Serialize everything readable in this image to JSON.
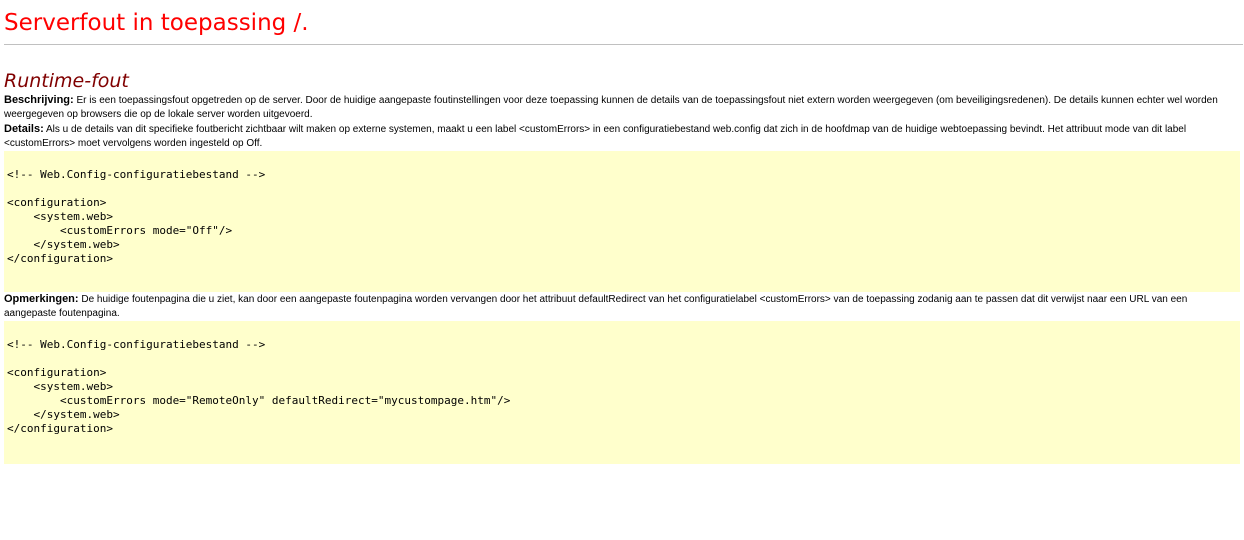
{
  "page": {
    "title": "Serverfout in toepassing /.",
    "subtitle": "Runtime-fout"
  },
  "description": {
    "label": "Beschrijving:",
    "text": " Er is een toepassingsfout opgetreden op de server. Door de huidige aangepaste foutinstellingen voor deze toepassing kunnen de details van de toepassingsfout niet extern worden weergegeven (om beveiligingsredenen). De details kunnen echter wel worden weergegeven op browsers die op de lokale server worden uitgevoerd."
  },
  "details": {
    "label": "Details:",
    "text": " Als u de details van dit specifieke foutbericht zichtbaar wilt maken op externe systemen, maakt u een label <customErrors> in een configuratiebestand web.config dat zich in de hoofdmap van de huidige webtoepassing bevindt. Het attribuut mode van dit label <customErrors> moet vervolgens worden ingesteld op Off."
  },
  "code_block_1": [
    "<!-- Web.Config-configuratiebestand -->",
    "",
    "<configuration>",
    "    <system.web>",
    "        <customErrors mode=\"Off\"/>",
    "    </system.web>",
    "</configuration>"
  ],
  "remarks": {
    "label": "Opmerkingen:",
    "text": " De huidige foutenpagina die u ziet, kan door een aangepaste foutenpagina worden vervangen door het attribuut defaultRedirect van het configuratielabel <customErrors> van de toepassing zodanig aan te passen dat dit verwijst naar een URL van een aangepaste foutenpagina."
  },
  "code_block_2": [
    "<!-- Web.Config-configuratiebestand -->",
    "",
    "<configuration>",
    "    <system.web>",
    "        <customErrors mode=\"RemoteOnly\" defaultRedirect=\"mycustompage.htm\"/>",
    "    </system.web>",
    "</configuration>"
  ],
  "colors": {
    "title": "#ff0000",
    "subtitle": "#800000",
    "code_background": "#ffffcc",
    "rule": "#c0c0c0"
  }
}
